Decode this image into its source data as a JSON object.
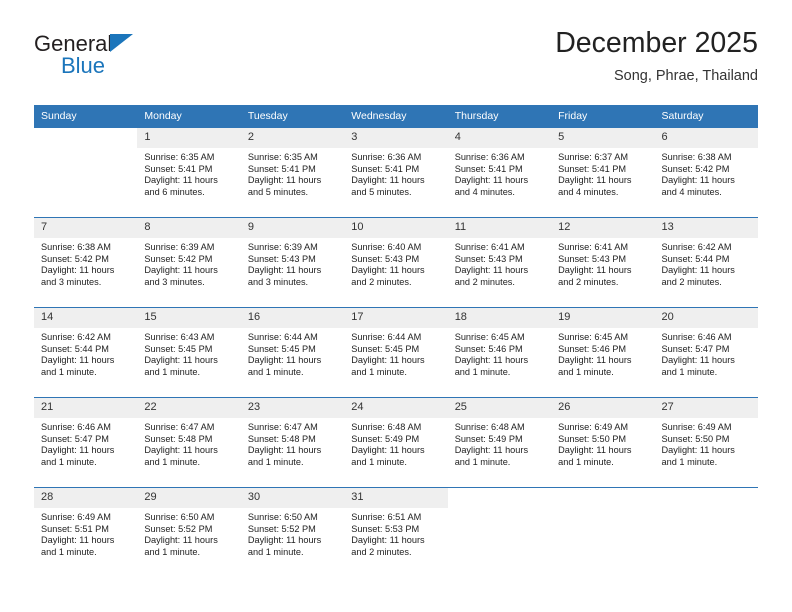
{
  "brand": {
    "line1": "General",
    "line2": "Blue",
    "triangle_color": "#1b75bb"
  },
  "header": {
    "title": "December 2025",
    "subtitle": "Song, Phrae, Thailand"
  },
  "theme": {
    "header_bg": "#2f75b5",
    "daynum_bg": "#efefef",
    "text": "#222222"
  },
  "calendar": {
    "weekday_headers": [
      "Sunday",
      "Monday",
      "Tuesday",
      "Wednesday",
      "Thursday",
      "Friday",
      "Saturday"
    ],
    "weeks": [
      [
        {
          "day": "",
          "blank": true,
          "sunrise": "",
          "sunset": "",
          "daylight1": "",
          "daylight2": ""
        },
        {
          "day": "1",
          "sunrise": "Sunrise: 6:35 AM",
          "sunset": "Sunset: 5:41 PM",
          "daylight1": "Daylight: 11 hours",
          "daylight2": "and 6 minutes."
        },
        {
          "day": "2",
          "sunrise": "Sunrise: 6:35 AM",
          "sunset": "Sunset: 5:41 PM",
          "daylight1": "Daylight: 11 hours",
          "daylight2": "and 5 minutes."
        },
        {
          "day": "3",
          "sunrise": "Sunrise: 6:36 AM",
          "sunset": "Sunset: 5:41 PM",
          "daylight1": "Daylight: 11 hours",
          "daylight2": "and 5 minutes."
        },
        {
          "day": "4",
          "sunrise": "Sunrise: 6:36 AM",
          "sunset": "Sunset: 5:41 PM",
          "daylight1": "Daylight: 11 hours",
          "daylight2": "and 4 minutes."
        },
        {
          "day": "5",
          "sunrise": "Sunrise: 6:37 AM",
          "sunset": "Sunset: 5:41 PM",
          "daylight1": "Daylight: 11 hours",
          "daylight2": "and 4 minutes."
        },
        {
          "day": "6",
          "sunrise": "Sunrise: 6:38 AM",
          "sunset": "Sunset: 5:42 PM",
          "daylight1": "Daylight: 11 hours",
          "daylight2": "and 4 minutes."
        }
      ],
      [
        {
          "day": "7",
          "sunrise": "Sunrise: 6:38 AM",
          "sunset": "Sunset: 5:42 PM",
          "daylight1": "Daylight: 11 hours",
          "daylight2": "and 3 minutes."
        },
        {
          "day": "8",
          "sunrise": "Sunrise: 6:39 AM",
          "sunset": "Sunset: 5:42 PM",
          "daylight1": "Daylight: 11 hours",
          "daylight2": "and 3 minutes."
        },
        {
          "day": "9",
          "sunrise": "Sunrise: 6:39 AM",
          "sunset": "Sunset: 5:43 PM",
          "daylight1": "Daylight: 11 hours",
          "daylight2": "and 3 minutes."
        },
        {
          "day": "10",
          "sunrise": "Sunrise: 6:40 AM",
          "sunset": "Sunset: 5:43 PM",
          "daylight1": "Daylight: 11 hours",
          "daylight2": "and 2 minutes."
        },
        {
          "day": "11",
          "sunrise": "Sunrise: 6:41 AM",
          "sunset": "Sunset: 5:43 PM",
          "daylight1": "Daylight: 11 hours",
          "daylight2": "and 2 minutes."
        },
        {
          "day": "12",
          "sunrise": "Sunrise: 6:41 AM",
          "sunset": "Sunset: 5:43 PM",
          "daylight1": "Daylight: 11 hours",
          "daylight2": "and 2 minutes."
        },
        {
          "day": "13",
          "sunrise": "Sunrise: 6:42 AM",
          "sunset": "Sunset: 5:44 PM",
          "daylight1": "Daylight: 11 hours",
          "daylight2": "and 2 minutes."
        }
      ],
      [
        {
          "day": "14",
          "sunrise": "Sunrise: 6:42 AM",
          "sunset": "Sunset: 5:44 PM",
          "daylight1": "Daylight: 11 hours",
          "daylight2": "and 1 minute."
        },
        {
          "day": "15",
          "sunrise": "Sunrise: 6:43 AM",
          "sunset": "Sunset: 5:45 PM",
          "daylight1": "Daylight: 11 hours",
          "daylight2": "and 1 minute."
        },
        {
          "day": "16",
          "sunrise": "Sunrise: 6:44 AM",
          "sunset": "Sunset: 5:45 PM",
          "daylight1": "Daylight: 11 hours",
          "daylight2": "and 1 minute."
        },
        {
          "day": "17",
          "sunrise": "Sunrise: 6:44 AM",
          "sunset": "Sunset: 5:45 PM",
          "daylight1": "Daylight: 11 hours",
          "daylight2": "and 1 minute."
        },
        {
          "day": "18",
          "sunrise": "Sunrise: 6:45 AM",
          "sunset": "Sunset: 5:46 PM",
          "daylight1": "Daylight: 11 hours",
          "daylight2": "and 1 minute."
        },
        {
          "day": "19",
          "sunrise": "Sunrise: 6:45 AM",
          "sunset": "Sunset: 5:46 PM",
          "daylight1": "Daylight: 11 hours",
          "daylight2": "and 1 minute."
        },
        {
          "day": "20",
          "sunrise": "Sunrise: 6:46 AM",
          "sunset": "Sunset: 5:47 PM",
          "daylight1": "Daylight: 11 hours",
          "daylight2": "and 1 minute."
        }
      ],
      [
        {
          "day": "21",
          "sunrise": "Sunrise: 6:46 AM",
          "sunset": "Sunset: 5:47 PM",
          "daylight1": "Daylight: 11 hours",
          "daylight2": "and 1 minute."
        },
        {
          "day": "22",
          "sunrise": "Sunrise: 6:47 AM",
          "sunset": "Sunset: 5:48 PM",
          "daylight1": "Daylight: 11 hours",
          "daylight2": "and 1 minute."
        },
        {
          "day": "23",
          "sunrise": "Sunrise: 6:47 AM",
          "sunset": "Sunset: 5:48 PM",
          "daylight1": "Daylight: 11 hours",
          "daylight2": "and 1 minute."
        },
        {
          "day": "24",
          "sunrise": "Sunrise: 6:48 AM",
          "sunset": "Sunset: 5:49 PM",
          "daylight1": "Daylight: 11 hours",
          "daylight2": "and 1 minute."
        },
        {
          "day": "25",
          "sunrise": "Sunrise: 6:48 AM",
          "sunset": "Sunset: 5:49 PM",
          "daylight1": "Daylight: 11 hours",
          "daylight2": "and 1 minute."
        },
        {
          "day": "26",
          "sunrise": "Sunrise: 6:49 AM",
          "sunset": "Sunset: 5:50 PM",
          "daylight1": "Daylight: 11 hours",
          "daylight2": "and 1 minute."
        },
        {
          "day": "27",
          "sunrise": "Sunrise: 6:49 AM",
          "sunset": "Sunset: 5:50 PM",
          "daylight1": "Daylight: 11 hours",
          "daylight2": "and 1 minute."
        }
      ],
      [
        {
          "day": "28",
          "sunrise": "Sunrise: 6:49 AM",
          "sunset": "Sunset: 5:51 PM",
          "daylight1": "Daylight: 11 hours",
          "daylight2": "and 1 minute."
        },
        {
          "day": "29",
          "sunrise": "Sunrise: 6:50 AM",
          "sunset": "Sunset: 5:52 PM",
          "daylight1": "Daylight: 11 hours",
          "daylight2": "and 1 minute."
        },
        {
          "day": "30",
          "sunrise": "Sunrise: 6:50 AM",
          "sunset": "Sunset: 5:52 PM",
          "daylight1": "Daylight: 11 hours",
          "daylight2": "and 1 minute."
        },
        {
          "day": "31",
          "sunrise": "Sunrise: 6:51 AM",
          "sunset": "Sunset: 5:53 PM",
          "daylight1": "Daylight: 11 hours",
          "daylight2": "and 2 minutes."
        },
        {
          "day": "",
          "blank": true,
          "sunrise": "",
          "sunset": "",
          "daylight1": "",
          "daylight2": ""
        },
        {
          "day": "",
          "blank": true,
          "sunrise": "",
          "sunset": "",
          "daylight1": "",
          "daylight2": ""
        },
        {
          "day": "",
          "blank": true,
          "sunrise": "",
          "sunset": "",
          "daylight1": "",
          "daylight2": ""
        }
      ]
    ]
  }
}
